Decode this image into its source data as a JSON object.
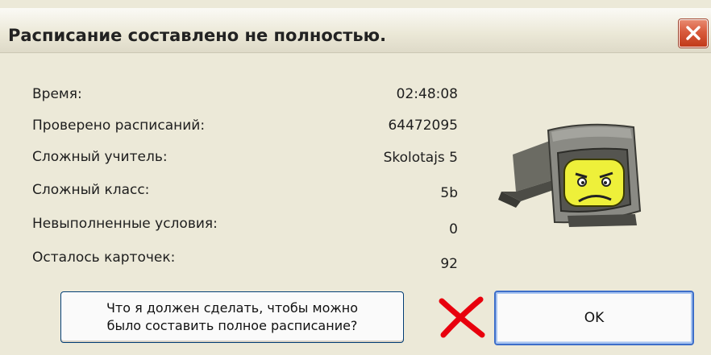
{
  "window": {
    "title": "Расписание составлено не полностью.",
    "close_icon": "close-icon"
  },
  "fields": [
    {
      "label": "Время:",
      "value": "02:48:08"
    },
    {
      "label": "Проверено расписаний:",
      "value": "64472095"
    },
    {
      "label": "Сложный учитель:",
      "value": "Skolotajs 5"
    },
    {
      "label": "Сложный класс:",
      "value": "5b"
    },
    {
      "label": "Невыполненные условия:",
      "value": "0"
    },
    {
      "label": "Осталось карточек:",
      "value": "92"
    }
  ],
  "icons": {
    "status": "sad-computer-icon",
    "annotation": "red-x-mark-icon"
  },
  "buttons": {
    "help_line1": "Что я должен сделать, чтобы можно",
    "help_line2": "было составить полное расписание?",
    "ok": "OK"
  },
  "colors": {
    "dialog_bg": "#ece9d8",
    "close_button": "#d85a3c",
    "button_border": "#003c74",
    "annotation_red": "#e8000d"
  }
}
